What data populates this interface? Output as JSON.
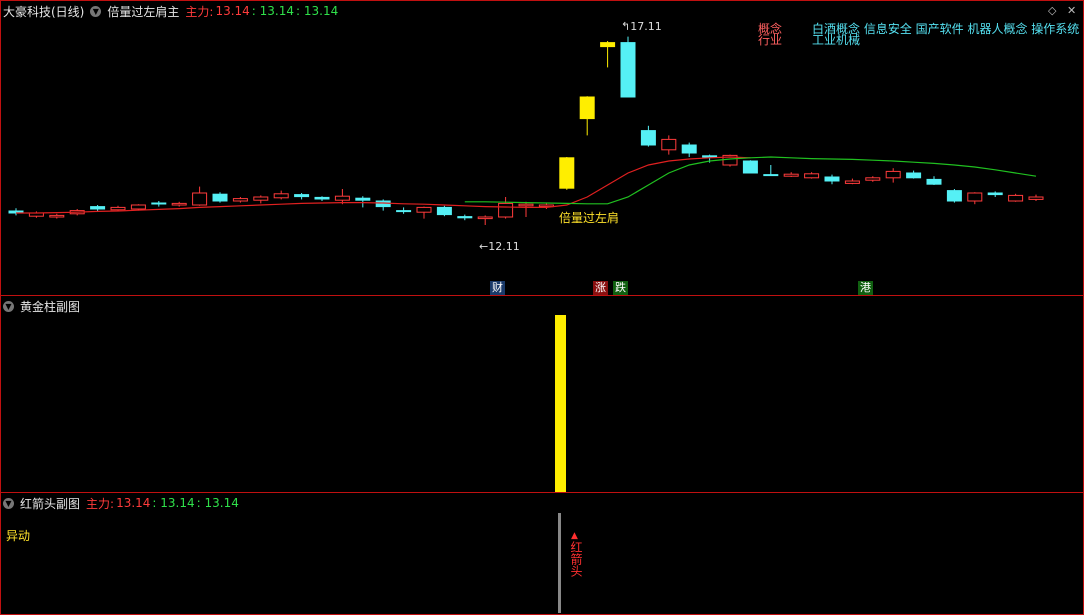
{
  "main": {
    "stock_title": "大豪科技(日线)",
    "indicator_name": "倍量过左肩主",
    "main_force_label": "主力:",
    "value1": "13.14",
    "value2": ": 13.14",
    "value3": ": 13.14",
    "concept_key": "概念",
    "industry_key": "行业",
    "concept_value": "白酒概念 信息安全 国产软件 机器人概念 操作系统",
    "industry_value": "工业机械",
    "high_label": "17.11",
    "low_label": "12.11",
    "signal_label": "倍量过左肩",
    "event_tags": [
      {
        "text": "财",
        "color": "#ffffff",
        "bg": "#1a3a6a"
      },
      {
        "text": "涨",
        "color": "#ffffff",
        "bg": "#8a1010"
      },
      {
        "text": "跌",
        "color": "#ffffff",
        "bg": "#106010"
      },
      {
        "text": "港",
        "color": "#ffffff",
        "bg": "#106010"
      }
    ]
  },
  "sub1": {
    "title": "黄金柱副图"
  },
  "sub2": {
    "title": "红箭头副图",
    "main_force_label": "主力:",
    "value1": "13.14",
    "value2": ": 13.14",
    "value3": ": 13.14",
    "anomaly_label": "异动",
    "arrow_text": "红箭头"
  },
  "colors": {
    "up": "#ff3b3b",
    "down": "#55f0f5",
    "highlight": "#ffee00",
    "ma_red": "#e02020",
    "ma_green": "#20c020"
  },
  "chart_data": {
    "type": "candlestick",
    "ylim": [
      11.5,
      17.5
    ],
    "candles": [
      {
        "o": 12.75,
        "c": 12.7,
        "h": 12.82,
        "l": 12.64,
        "up": false
      },
      {
        "o": 12.62,
        "c": 12.7,
        "h": 12.74,
        "l": 12.58,
        "up": true
      },
      {
        "o": 12.6,
        "c": 12.64,
        "h": 12.68,
        "l": 12.56,
        "up": true
      },
      {
        "o": 12.68,
        "c": 12.76,
        "h": 12.8,
        "l": 12.64,
        "up": true
      },
      {
        "o": 12.86,
        "c": 12.8,
        "h": 12.9,
        "l": 12.74,
        "up": false
      },
      {
        "o": 12.78,
        "c": 12.84,
        "h": 12.88,
        "l": 12.74,
        "up": true
      },
      {
        "o": 12.8,
        "c": 12.9,
        "h": 12.92,
        "l": 12.76,
        "up": true
      },
      {
        "o": 12.95,
        "c": 12.93,
        "h": 13.0,
        "l": 12.86,
        "up": false
      },
      {
        "o": 12.9,
        "c": 12.94,
        "h": 12.98,
        "l": 12.86,
        "up": true
      },
      {
        "o": 12.9,
        "c": 13.2,
        "h": 13.36,
        "l": 12.88,
        "up": true
      },
      {
        "o": 13.17,
        "c": 13.0,
        "h": 13.22,
        "l": 12.96,
        "up": false
      },
      {
        "o": 13.0,
        "c": 13.06,
        "h": 13.1,
        "l": 12.96,
        "up": true
      },
      {
        "o": 13.02,
        "c": 13.1,
        "h": 13.14,
        "l": 12.94,
        "up": true
      },
      {
        "o": 13.08,
        "c": 13.18,
        "h": 13.26,
        "l": 13.04,
        "up": true
      },
      {
        "o": 13.16,
        "c": 13.11,
        "h": 13.2,
        "l": 13.04,
        "up": false
      },
      {
        "o": 13.09,
        "c": 13.05,
        "h": 13.12,
        "l": 13.0,
        "up": false
      },
      {
        "o": 13.02,
        "c": 13.12,
        "h": 13.3,
        "l": 12.92,
        "up": true
      },
      {
        "o": 13.07,
        "c": 13.02,
        "h": 13.12,
        "l": 12.84,
        "up": false
      },
      {
        "o": 13.0,
        "c": 12.86,
        "h": 13.04,
        "l": 12.76,
        "up": false
      },
      {
        "o": 12.75,
        "c": 12.76,
        "h": 12.84,
        "l": 12.68,
        "up": false
      },
      {
        "o": 12.72,
        "c": 12.84,
        "h": 12.86,
        "l": 12.56,
        "up": true
      },
      {
        "o": 12.84,
        "c": 12.66,
        "h": 12.88,
        "l": 12.62,
        "up": false
      },
      {
        "o": 12.61,
        "c": 12.58,
        "h": 12.66,
        "l": 12.52,
        "up": false
      },
      {
        "o": 12.56,
        "c": 12.6,
        "h": 12.64,
        "l": 12.4,
        "up": true
      },
      {
        "o": 12.6,
        "c": 12.94,
        "h": 13.1,
        "l": 12.56,
        "up": true
      },
      {
        "o": 12.88,
        "c": 12.92,
        "h": 12.98,
        "l": 12.6,
        "up": true
      },
      {
        "o": 12.86,
        "c": 12.9,
        "h": 12.96,
        "l": 12.8,
        "up": true
      },
      {
        "o": 13.32,
        "c": 14.08,
        "h": 14.1,
        "l": 13.28,
        "up": true,
        "gold": true
      },
      {
        "o": 15.06,
        "c": 15.6,
        "h": 15.62,
        "l": 14.64,
        "up": true,
        "gold": true
      },
      {
        "o": 16.96,
        "c": 16.86,
        "h": 17.0,
        "l": 16.34,
        "up": true,
        "gold": true
      },
      {
        "o": 16.96,
        "c": 15.6,
        "h": 17.11,
        "l": 15.6,
        "up": false
      },
      {
        "o": 14.76,
        "c": 14.4,
        "h": 14.88,
        "l": 14.36,
        "up": false
      },
      {
        "o": 14.28,
        "c": 14.54,
        "h": 14.64,
        "l": 14.16,
        "up": true
      },
      {
        "o": 14.4,
        "c": 14.2,
        "h": 14.46,
        "l": 14.1,
        "up": false
      },
      {
        "o": 14.13,
        "c": 14.1,
        "h": 14.16,
        "l": 13.96,
        "up": false
      },
      {
        "o": 13.9,
        "c": 14.14,
        "h": 14.16,
        "l": 13.86,
        "up": true
      },
      {
        "o": 14.0,
        "c": 13.7,
        "h": 14.02,
        "l": 13.7,
        "up": false
      },
      {
        "o": 13.66,
        "c": 13.65,
        "h": 13.9,
        "l": 13.64,
        "up": false
      },
      {
        "o": 13.62,
        "c": 13.67,
        "h": 13.72,
        "l": 13.6,
        "up": true
      },
      {
        "o": 13.58,
        "c": 13.68,
        "h": 13.72,
        "l": 13.56,
        "up": true
      },
      {
        "o": 13.6,
        "c": 13.5,
        "h": 13.66,
        "l": 13.42,
        "up": false
      },
      {
        "o": 13.44,
        "c": 13.5,
        "h": 13.56,
        "l": 13.42,
        "up": true
      },
      {
        "o": 13.52,
        "c": 13.58,
        "h": 13.62,
        "l": 13.48,
        "up": true
      },
      {
        "o": 13.58,
        "c": 13.74,
        "h": 13.82,
        "l": 13.46,
        "up": true
      },
      {
        "o": 13.7,
        "c": 13.58,
        "h": 13.76,
        "l": 13.56,
        "up": false
      },
      {
        "o": 13.54,
        "c": 13.42,
        "h": 13.62,
        "l": 13.4,
        "up": false
      },
      {
        "o": 13.26,
        "c": 13.0,
        "h": 13.3,
        "l": 12.96,
        "up": false
      },
      {
        "o": 13.0,
        "c": 13.2,
        "h": 13.22,
        "l": 12.92,
        "up": true
      },
      {
        "o": 13.2,
        "c": 13.16,
        "h": 13.24,
        "l": 13.1,
        "up": false
      },
      {
        "o": 13.0,
        "c": 13.14,
        "h": 13.18,
        "l": 12.98,
        "up": true
      },
      {
        "o": 13.04,
        "c": 13.1,
        "h": 13.16,
        "l": 13.0,
        "up": true
      }
    ],
    "ma_red": [
      12.7,
      12.7,
      12.71,
      12.72,
      12.74,
      12.75,
      12.77,
      12.79,
      12.81,
      12.84,
      12.86,
      12.88,
      12.9,
      12.92,
      12.94,
      12.95,
      12.96,
      12.96,
      12.95,
      12.93,
      12.92,
      12.9,
      12.88,
      12.86,
      12.85,
      12.84,
      12.84,
      12.9,
      13.1,
      13.4,
      13.7,
      13.9,
      14.0,
      14.05,
      14.08,
      14.1,
      14.08
    ],
    "ma_green": [
      12.98,
      12.98,
      12.97,
      12.96,
      12.95,
      12.94,
      12.93,
      12.93,
      13.1,
      13.4,
      13.7,
      13.9,
      14.0,
      14.05,
      14.08,
      14.1,
      14.08,
      14.06,
      14.05,
      14.04,
      14.02,
      14.0,
      13.97,
      13.94,
      13.9,
      13.85,
      13.78,
      13.7,
      13.62
    ],
    "golden_bar_index": 27,
    "red_arrow_index": 27
  }
}
